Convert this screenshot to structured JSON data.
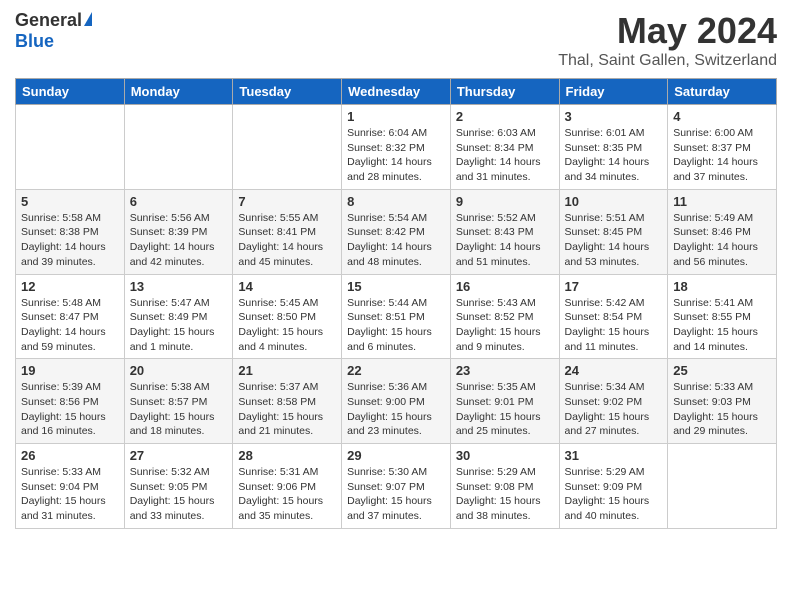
{
  "header": {
    "logo_general": "General",
    "logo_blue": "Blue",
    "month_title": "May 2024",
    "location": "Thal, Saint Gallen, Switzerland"
  },
  "weekdays": [
    "Sunday",
    "Monday",
    "Tuesday",
    "Wednesday",
    "Thursday",
    "Friday",
    "Saturday"
  ],
  "weeks": [
    [
      {
        "day": "",
        "info": ""
      },
      {
        "day": "",
        "info": ""
      },
      {
        "day": "",
        "info": ""
      },
      {
        "day": "1",
        "info": "Sunrise: 6:04 AM\nSunset: 8:32 PM\nDaylight: 14 hours\nand 28 minutes."
      },
      {
        "day": "2",
        "info": "Sunrise: 6:03 AM\nSunset: 8:34 PM\nDaylight: 14 hours\nand 31 minutes."
      },
      {
        "day": "3",
        "info": "Sunrise: 6:01 AM\nSunset: 8:35 PM\nDaylight: 14 hours\nand 34 minutes."
      },
      {
        "day": "4",
        "info": "Sunrise: 6:00 AM\nSunset: 8:37 PM\nDaylight: 14 hours\nand 37 minutes."
      }
    ],
    [
      {
        "day": "5",
        "info": "Sunrise: 5:58 AM\nSunset: 8:38 PM\nDaylight: 14 hours\nand 39 minutes."
      },
      {
        "day": "6",
        "info": "Sunrise: 5:56 AM\nSunset: 8:39 PM\nDaylight: 14 hours\nand 42 minutes."
      },
      {
        "day": "7",
        "info": "Sunrise: 5:55 AM\nSunset: 8:41 PM\nDaylight: 14 hours\nand 45 minutes."
      },
      {
        "day": "8",
        "info": "Sunrise: 5:54 AM\nSunset: 8:42 PM\nDaylight: 14 hours\nand 48 minutes."
      },
      {
        "day": "9",
        "info": "Sunrise: 5:52 AM\nSunset: 8:43 PM\nDaylight: 14 hours\nand 51 minutes."
      },
      {
        "day": "10",
        "info": "Sunrise: 5:51 AM\nSunset: 8:45 PM\nDaylight: 14 hours\nand 53 minutes."
      },
      {
        "day": "11",
        "info": "Sunrise: 5:49 AM\nSunset: 8:46 PM\nDaylight: 14 hours\nand 56 minutes."
      }
    ],
    [
      {
        "day": "12",
        "info": "Sunrise: 5:48 AM\nSunset: 8:47 PM\nDaylight: 14 hours\nand 59 minutes."
      },
      {
        "day": "13",
        "info": "Sunrise: 5:47 AM\nSunset: 8:49 PM\nDaylight: 15 hours\nand 1 minute."
      },
      {
        "day": "14",
        "info": "Sunrise: 5:45 AM\nSunset: 8:50 PM\nDaylight: 15 hours\nand 4 minutes."
      },
      {
        "day": "15",
        "info": "Sunrise: 5:44 AM\nSunset: 8:51 PM\nDaylight: 15 hours\nand 6 minutes."
      },
      {
        "day": "16",
        "info": "Sunrise: 5:43 AM\nSunset: 8:52 PM\nDaylight: 15 hours\nand 9 minutes."
      },
      {
        "day": "17",
        "info": "Sunrise: 5:42 AM\nSunset: 8:54 PM\nDaylight: 15 hours\nand 11 minutes."
      },
      {
        "day": "18",
        "info": "Sunrise: 5:41 AM\nSunset: 8:55 PM\nDaylight: 15 hours\nand 14 minutes."
      }
    ],
    [
      {
        "day": "19",
        "info": "Sunrise: 5:39 AM\nSunset: 8:56 PM\nDaylight: 15 hours\nand 16 minutes."
      },
      {
        "day": "20",
        "info": "Sunrise: 5:38 AM\nSunset: 8:57 PM\nDaylight: 15 hours\nand 18 minutes."
      },
      {
        "day": "21",
        "info": "Sunrise: 5:37 AM\nSunset: 8:58 PM\nDaylight: 15 hours\nand 21 minutes."
      },
      {
        "day": "22",
        "info": "Sunrise: 5:36 AM\nSunset: 9:00 PM\nDaylight: 15 hours\nand 23 minutes."
      },
      {
        "day": "23",
        "info": "Sunrise: 5:35 AM\nSunset: 9:01 PM\nDaylight: 15 hours\nand 25 minutes."
      },
      {
        "day": "24",
        "info": "Sunrise: 5:34 AM\nSunset: 9:02 PM\nDaylight: 15 hours\nand 27 minutes."
      },
      {
        "day": "25",
        "info": "Sunrise: 5:33 AM\nSunset: 9:03 PM\nDaylight: 15 hours\nand 29 minutes."
      }
    ],
    [
      {
        "day": "26",
        "info": "Sunrise: 5:33 AM\nSunset: 9:04 PM\nDaylight: 15 hours\nand 31 minutes."
      },
      {
        "day": "27",
        "info": "Sunrise: 5:32 AM\nSunset: 9:05 PM\nDaylight: 15 hours\nand 33 minutes."
      },
      {
        "day": "28",
        "info": "Sunrise: 5:31 AM\nSunset: 9:06 PM\nDaylight: 15 hours\nand 35 minutes."
      },
      {
        "day": "29",
        "info": "Sunrise: 5:30 AM\nSunset: 9:07 PM\nDaylight: 15 hours\nand 37 minutes."
      },
      {
        "day": "30",
        "info": "Sunrise: 5:29 AM\nSunset: 9:08 PM\nDaylight: 15 hours\nand 38 minutes."
      },
      {
        "day": "31",
        "info": "Sunrise: 5:29 AM\nSunset: 9:09 PM\nDaylight: 15 hours\nand 40 minutes."
      },
      {
        "day": "",
        "info": ""
      }
    ]
  ]
}
